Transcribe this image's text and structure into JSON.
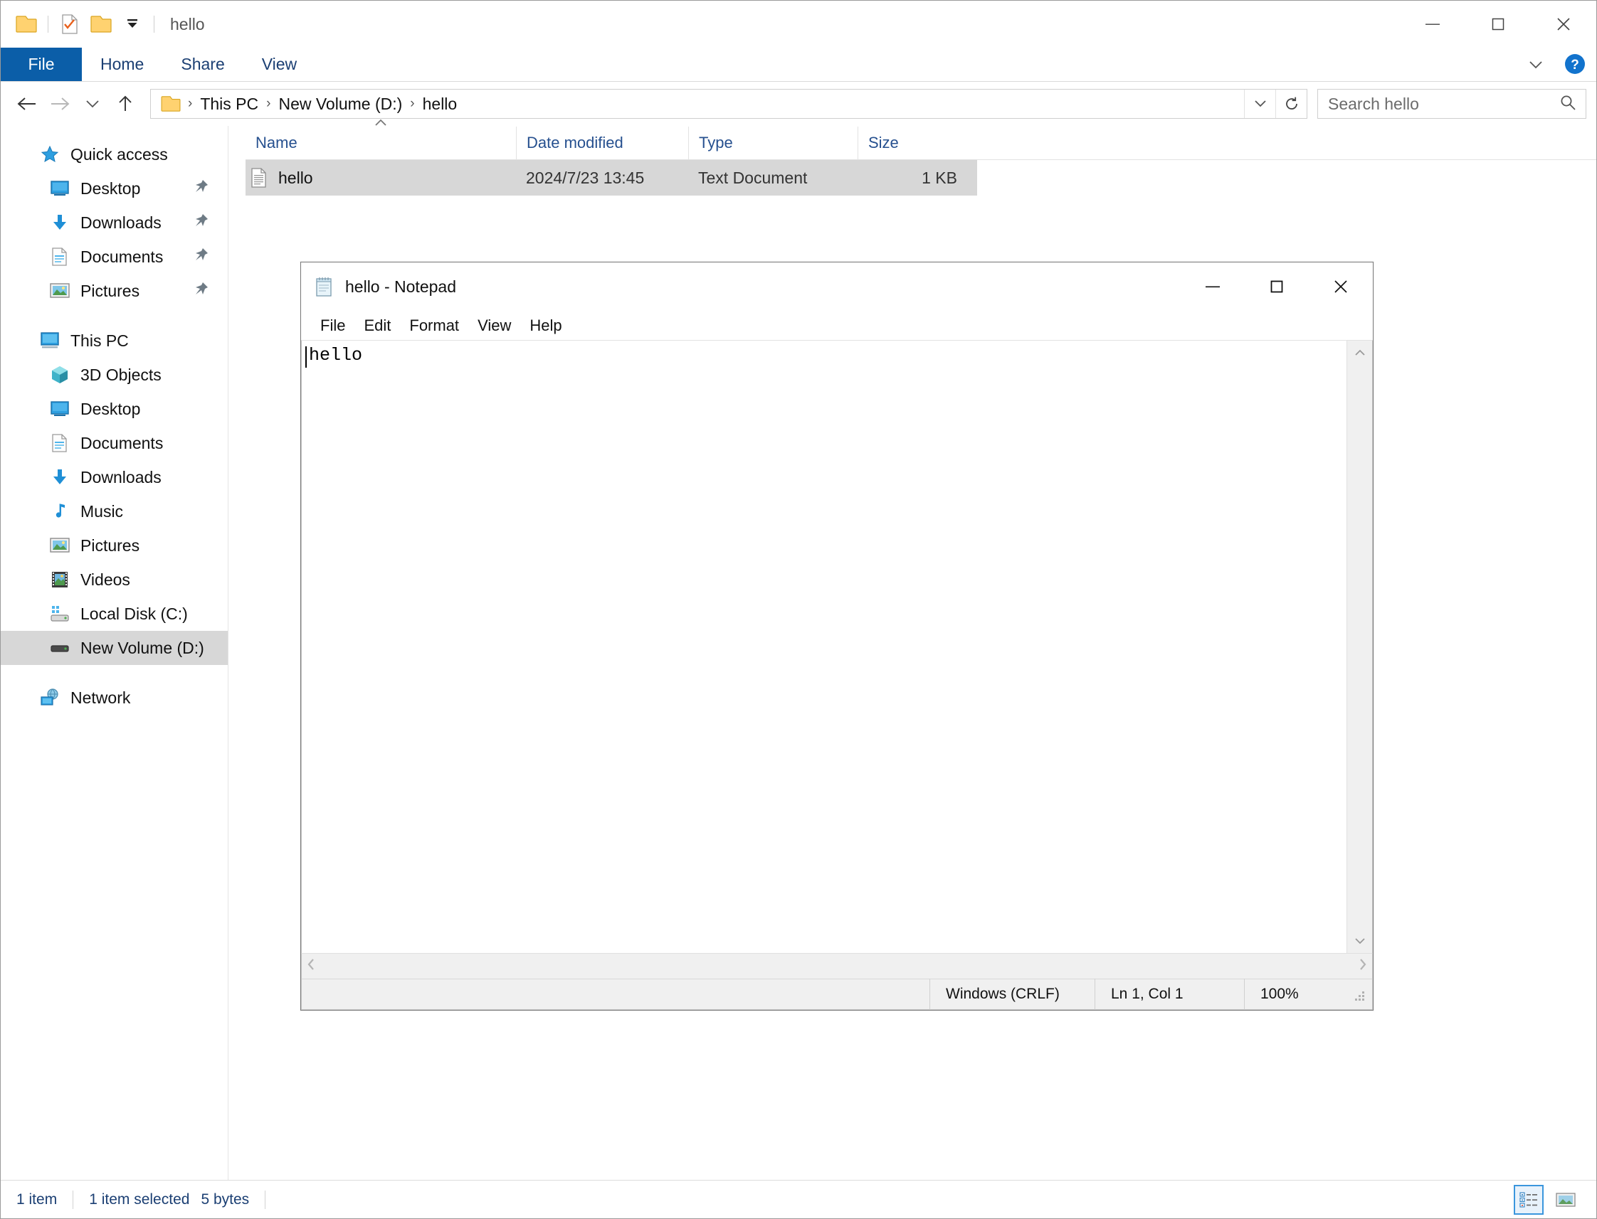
{
  "explorer": {
    "title": "hello",
    "quick_access_toolbar": [
      {
        "name": "properties-folder-icon",
        "label": "folder"
      },
      {
        "name": "new-folder-check-icon",
        "label": "new item"
      },
      {
        "name": "folder-icon",
        "label": "folder"
      },
      {
        "name": "customize-qat-icon",
        "label": "Customize Quick Access Toolbar"
      }
    ],
    "window_controls": {
      "minimize": "–",
      "maximize": "□",
      "close": "✕"
    },
    "ribbon": {
      "tabs": [
        {
          "label": "File",
          "selected": true
        },
        {
          "label": "Home",
          "selected": false
        },
        {
          "label": "Share",
          "selected": false
        },
        {
          "label": "View",
          "selected": false
        }
      ],
      "expand_label": "˅",
      "help_label": "?"
    },
    "navigation": {
      "back": "←",
      "forward": "→",
      "recent": "˅",
      "up": "↑"
    },
    "address": {
      "crumbs": [
        "This PC",
        "New Volume (D:)",
        "hello"
      ],
      "separator": "›",
      "dropdown": "˅",
      "refresh": "↻"
    },
    "search": {
      "placeholder": "Search hello",
      "value": "",
      "icon": "search-icon"
    },
    "sidebar": {
      "groups": [
        {
          "name": "quick-access",
          "items": [
            {
              "label": "Quick access",
              "icon": "star-pin-icon",
              "level": 0,
              "pinned": false,
              "selected": false
            },
            {
              "label": "Desktop",
              "icon": "desktop-icon",
              "level": 1,
              "pinned": true,
              "selected": false
            },
            {
              "label": "Downloads",
              "icon": "downloads-icon",
              "level": 1,
              "pinned": true,
              "selected": false
            },
            {
              "label": "Documents",
              "icon": "documents-icon",
              "level": 1,
              "pinned": true,
              "selected": false
            },
            {
              "label": "Pictures",
              "icon": "pictures-icon",
              "level": 1,
              "pinned": true,
              "selected": false
            }
          ]
        },
        {
          "name": "this-pc",
          "items": [
            {
              "label": "This PC",
              "icon": "this-pc-icon",
              "level": 0,
              "pinned": false,
              "selected": false
            },
            {
              "label": "3D Objects",
              "icon": "3d-objects-icon",
              "level": 1,
              "pinned": false,
              "selected": false
            },
            {
              "label": "Desktop",
              "icon": "desktop-icon",
              "level": 1,
              "pinned": false,
              "selected": false
            },
            {
              "label": "Documents",
              "icon": "documents-icon",
              "level": 1,
              "pinned": false,
              "selected": false
            },
            {
              "label": "Downloads",
              "icon": "downloads-icon",
              "level": 1,
              "pinned": false,
              "selected": false
            },
            {
              "label": "Music",
              "icon": "music-icon",
              "level": 1,
              "pinned": false,
              "selected": false
            },
            {
              "label": "Pictures",
              "icon": "pictures-icon",
              "level": 1,
              "pinned": false,
              "selected": false
            },
            {
              "label": "Videos",
              "icon": "videos-icon",
              "level": 1,
              "pinned": false,
              "selected": false
            },
            {
              "label": "Local Disk (C:)",
              "icon": "system-drive-icon",
              "level": 1,
              "pinned": false,
              "selected": false
            },
            {
              "label": "New Volume (D:)",
              "icon": "drive-icon",
              "level": 1,
              "pinned": false,
              "selected": true
            }
          ]
        },
        {
          "name": "network",
          "items": [
            {
              "label": "Network",
              "icon": "network-icon",
              "level": 0,
              "pinned": false,
              "selected": false
            }
          ]
        }
      ]
    },
    "file_list": {
      "columns": [
        {
          "key": "name",
          "label": "Name",
          "sorted": true,
          "sort_caret": "˄"
        },
        {
          "key": "date",
          "label": "Date modified",
          "sorted": false
        },
        {
          "key": "type",
          "label": "Type",
          "sorted": false
        },
        {
          "key": "size",
          "label": "Size",
          "sorted": false
        }
      ],
      "rows": [
        {
          "name": "hello",
          "date": "2024/7/23 13:45",
          "type": "Text Document",
          "size": "1 KB",
          "icon": "text-file-icon",
          "selected": true
        }
      ]
    },
    "status": {
      "item_count": "1 item",
      "selection": "1 item selected",
      "selection_size": "5 bytes",
      "view_buttons": [
        {
          "name": "details-view-button",
          "active": true
        },
        {
          "name": "large-icons-view-button",
          "active": false
        }
      ]
    }
  },
  "notepad": {
    "title": "hello - Notepad",
    "icon": "notepad-icon",
    "window_controls": {
      "minimize": "–",
      "maximize": "□",
      "close": "✕"
    },
    "menu": [
      "File",
      "Edit",
      "Format",
      "View",
      "Help"
    ],
    "document": {
      "text": "hello",
      "caret_line": 1,
      "caret_col": 1
    },
    "scrollbars": {
      "v_up": "˄",
      "v_down": "˅",
      "h_left": "‹",
      "h_right": "›"
    },
    "status": {
      "line_ending": "Windows (CRLF)",
      "position": "Ln 1, Col 1",
      "zoom": "100%"
    }
  }
}
